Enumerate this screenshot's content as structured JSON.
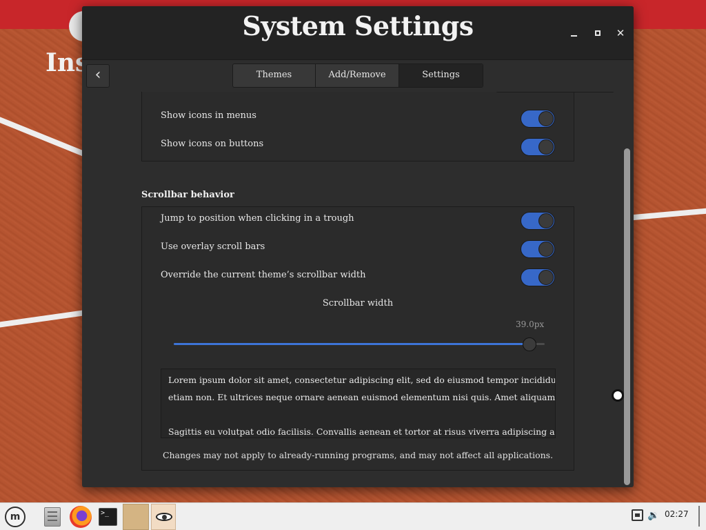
{
  "desktop": {
    "partial_title": "Ins"
  },
  "window": {
    "title": "System Settings",
    "controls": {
      "minimize": "minimize",
      "maximize": "maximize",
      "close": "✕"
    }
  },
  "nav": {
    "back_glyph": "‹"
  },
  "tabs": [
    {
      "label": "Themes"
    },
    {
      "label": "Add/Remove"
    },
    {
      "label": "Settings",
      "selected": true
    }
  ],
  "icons_section": {
    "rows": [
      {
        "label": "Show icons in menus",
        "enabled": true
      },
      {
        "label": "Show icons on buttons",
        "enabled": true
      }
    ]
  },
  "scrollbar_section": {
    "heading": "Scrollbar behavior",
    "rows": [
      {
        "label": "Jump to position when clicking in a trough",
        "enabled": true
      },
      {
        "label": "Use overlay scroll bars",
        "enabled": true
      },
      {
        "label": "Override the current theme’s scrollbar width",
        "enabled": true
      }
    ],
    "slider": {
      "caption": "Scrollbar width",
      "value_text": "39.0px",
      "fraction": 0.96
    },
    "preview_lines": [
      "Lorem ipsum dolor sit amet, consectetur adipiscing elit, sed do eiusmod tempor incididunt ut lab",
      "etiam non. Et ultrices neque ornare aenean euismod elementum nisi quis. Amet aliquam id diam",
      "Sagittis eu volutpat odio facilisis. Convallis aenean et tortor at risus viverra adipiscing at. Sapien e"
    ],
    "notice": "Changes may not apply to already-running programs, and may not affect all applications."
  },
  "taskbar": {
    "menu_logo": "m",
    "terminal_prompt": ">_",
    "clock": "02:27",
    "volume_glyph": "🔉"
  }
}
